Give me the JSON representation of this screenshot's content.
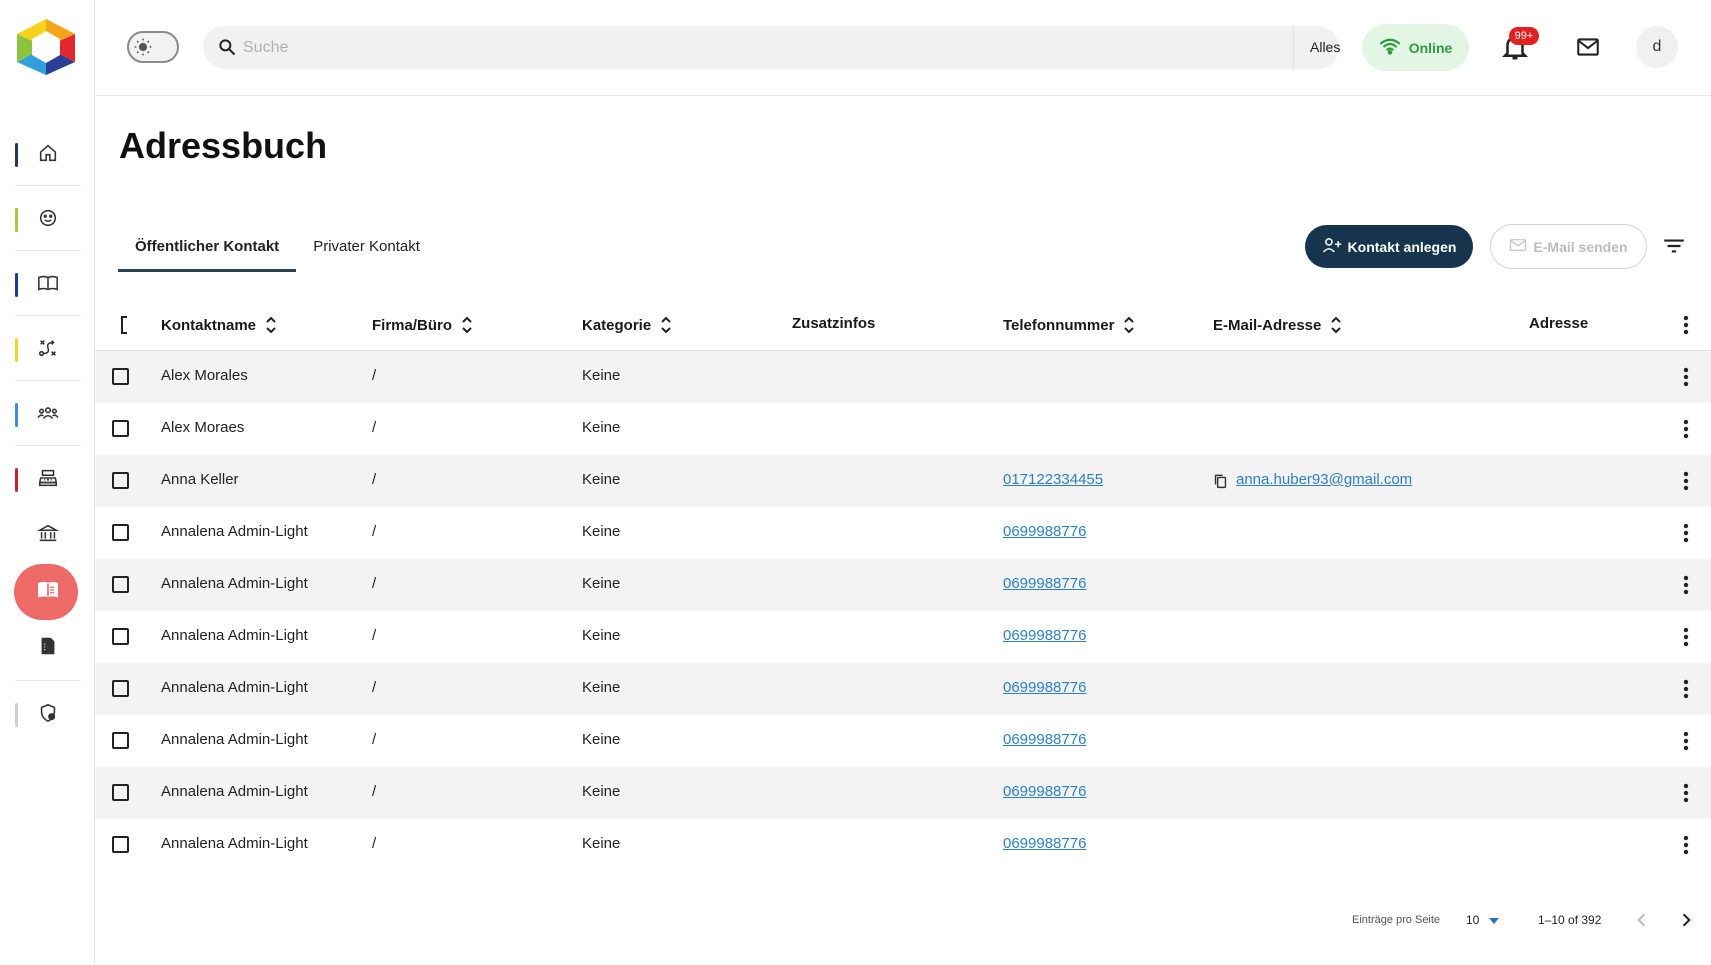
{
  "topbar": {
    "search_placeholder": "Suche",
    "scope_selected": "Alles",
    "status_label": "Online",
    "notification_count": "99+",
    "avatar_initial": "d"
  },
  "sidebar": {
    "items": [
      {
        "icon": "home-icon",
        "accent": "#1f3a5c"
      },
      {
        "icon": "smiley-icon",
        "accent": "#a6c93a"
      },
      {
        "icon": "book-open-icon",
        "accent": "#1f3a8a"
      },
      {
        "icon": "route-icon",
        "accent": "#e8d82b"
      },
      {
        "icon": "group-icon",
        "accent": "#3c8fd6"
      },
      {
        "icon": "cash-register-icon",
        "accent": "#c2272d"
      },
      {
        "icon": "bank-icon",
        "accent": ""
      },
      {
        "icon": "address-book-icon",
        "accent": "#ee6a68",
        "active": true
      },
      {
        "icon": "document-icon",
        "accent": ""
      },
      {
        "icon": "shield-user-icon",
        "accent": "#cfcfcf"
      }
    ]
  },
  "page": {
    "title": "Adressbuch"
  },
  "tabs": [
    {
      "label": "Öffentlicher Kontakt",
      "active": true
    },
    {
      "label": "Privater Kontakt",
      "active": false
    }
  ],
  "actions": {
    "create_contact": "Kontakt anlegen",
    "send_email": "E-Mail senden"
  },
  "table": {
    "columns": {
      "name": "Kontaktname",
      "company": "Firma/Büro",
      "category": "Kategorie",
      "extra": "Zusatzinfos",
      "phone": "Telefonnummer",
      "email": "E-Mail-Adresse",
      "address": "Adresse"
    },
    "rows": [
      {
        "name": "Alex Morales",
        "company": "/",
        "category": "Keine",
        "phone": "",
        "email": ""
      },
      {
        "name": "Alex Moraes",
        "company": "/",
        "category": "Keine",
        "phone": "",
        "email": ""
      },
      {
        "name": "Anna Keller",
        "company": "/",
        "category": "Keine",
        "phone": "017122334455",
        "email": "anna.huber93@gmail.com"
      },
      {
        "name": "Annalena Admin-Light",
        "company": "/",
        "category": "Keine",
        "phone": "0699988776",
        "email": ""
      },
      {
        "name": "Annalena Admin-Light",
        "company": "/",
        "category": "Keine",
        "phone": "0699988776",
        "email": ""
      },
      {
        "name": "Annalena Admin-Light",
        "company": "/",
        "category": "Keine",
        "phone": "0699988776",
        "email": ""
      },
      {
        "name": "Annalena Admin-Light",
        "company": "/",
        "category": "Keine",
        "phone": "0699988776",
        "email": ""
      },
      {
        "name": "Annalena Admin-Light",
        "company": "/",
        "category": "Keine",
        "phone": "0699988776",
        "email": ""
      },
      {
        "name": "Annalena Admin-Light",
        "company": "/",
        "category": "Keine",
        "phone": "0699988776",
        "email": ""
      },
      {
        "name": "Annalena Admin-Light",
        "company": "/",
        "category": "Keine",
        "phone": "0699988776",
        "email": ""
      }
    ]
  },
  "pagination": {
    "per_page_label": "Einträge pro Seite",
    "per_page": "10",
    "range": "1–10 of 392"
  },
  "colors": {
    "primary": "#16344d",
    "link": "#2d7fc4",
    "online_bg": "#e3f5e4",
    "online_text": "#2f9a3b",
    "active_nav": "#ee6a68",
    "badge": "#e22020"
  }
}
